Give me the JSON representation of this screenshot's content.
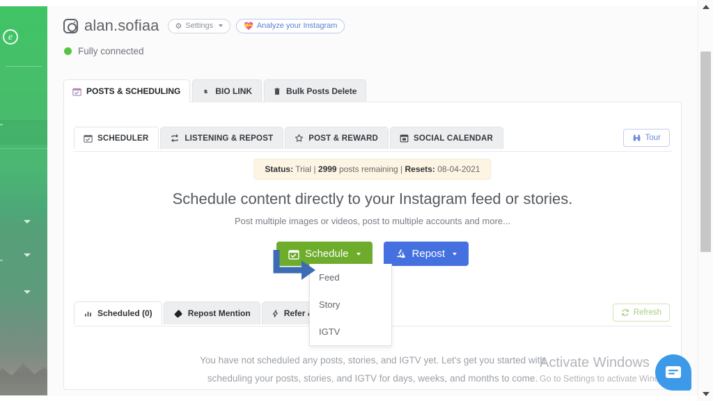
{
  "sidebar": {
    "logo_letter": "e"
  },
  "account": {
    "instagram_icon": "instagram-icon",
    "username": "alan.sofiaa",
    "settings_label": "Settings",
    "analyze_label": "Analyze your Instagram",
    "connection_status": "Fully connected"
  },
  "outer_tabs": [
    {
      "label": "POSTS & SCHEDULING",
      "icon": "calendar-check-icon",
      "active": true
    },
    {
      "label": "BIO LINK",
      "icon": "link-icon",
      "active": false
    },
    {
      "label": "Bulk Posts Delete",
      "icon": "trash-icon",
      "active": false
    }
  ],
  "inner_tabs": [
    {
      "label": "SCHEDULER",
      "icon": "calendar-check-icon",
      "active": true
    },
    {
      "label": "LISTENING & REPOST",
      "icon": "repeat-icon",
      "active": false
    },
    {
      "label": "POST & REWARD",
      "icon": "star-icon",
      "active": false
    },
    {
      "label": "SOCIAL CALENDAR",
      "icon": "calendar-icon",
      "active": false
    }
  ],
  "tour_button": {
    "label": "Tour",
    "icon": "binoculars-icon"
  },
  "status_banner": {
    "status_label": "Status:",
    "status_value": "Trial",
    "sep1": "|",
    "posts_count": "2999",
    "posts_text": "posts remaining",
    "sep2": "|",
    "resets_label": "Resets:",
    "resets_value": "08-04-2021"
  },
  "headline": "Schedule content directly to your Instagram feed or stories.",
  "subheadline": "Post multiple images or videos, post to multiple accounts and more...",
  "actions": {
    "schedule_label": "Schedule",
    "schedule_icon": "calendar-check-icon",
    "schedule_color": "#6eac2c",
    "repost_label": "Repost",
    "repost_icon": "recycle-icon",
    "repost_color": "#4470e0"
  },
  "dropdown": {
    "open": true,
    "items": [
      {
        "label": "Feed"
      },
      {
        "label": "Story"
      },
      {
        "label": "IGTV"
      }
    ]
  },
  "annotation": {
    "type": "arrow",
    "color": "#3c6cb4"
  },
  "lower_tabs": [
    {
      "label": "Scheduled (0)",
      "icon": "chart-bar-icon",
      "active": true
    },
    {
      "label": "Repost Mention",
      "icon": "tag-icon",
      "active": false
    },
    {
      "label": "Refer & Earn",
      "icon": "bolt-icon",
      "active": false
    }
  ],
  "refresh_button": {
    "label": "Refresh",
    "icon": "refresh-icon"
  },
  "empty_state": {
    "line1": "You have not scheduled any posts, stories, and IGTV yet. Let's get you started with",
    "line2": "scheduling your posts, stories, and IGTV for days, weeks, and months to come."
  },
  "watermark": {
    "title": "Activate Windows",
    "subtitle": "Go to Settings to activate Windows."
  },
  "chat_widget": {
    "icon": "chat-message-icon",
    "color": "#3d9ae8"
  },
  "scrollbar": {
    "up_icon": "triangle-up-icon",
    "down_icon": "triangle-down-icon"
  }
}
